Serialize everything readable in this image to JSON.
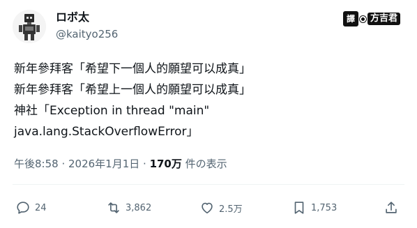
{
  "user": {
    "display_name": "ロボ太",
    "handle": "@kaityo256"
  },
  "watermark": {
    "badge": "譯",
    "name": "方吉君"
  },
  "tweet": {
    "lines": [
      "新年參拜客「希望下一個人的願望可以成真」",
      "新年參拜客「希望上一個人的願望可以成真」",
      "神社「Exception in thread \"main\"",
      "java.lang.StackOverflowError」"
    ]
  },
  "meta": {
    "timestamp": "午後8:58 · 2026年1月1日 · ",
    "views_count": "170万",
    "views_label": " 件の表示"
  },
  "actions": {
    "replies": "24",
    "retweets": "3,862",
    "likes": "2.5万",
    "bookmarks": "1,753"
  },
  "icons": {
    "reply": "speech-bubble-icon",
    "retweet": "retweet-arrows-icon",
    "like": "heart-icon",
    "bookmark": "bookmark-icon",
    "share": "share-upload-icon"
  },
  "colors": {
    "text": "#0f1419",
    "secondary": "#536471",
    "divider": "#eff3f4"
  }
}
